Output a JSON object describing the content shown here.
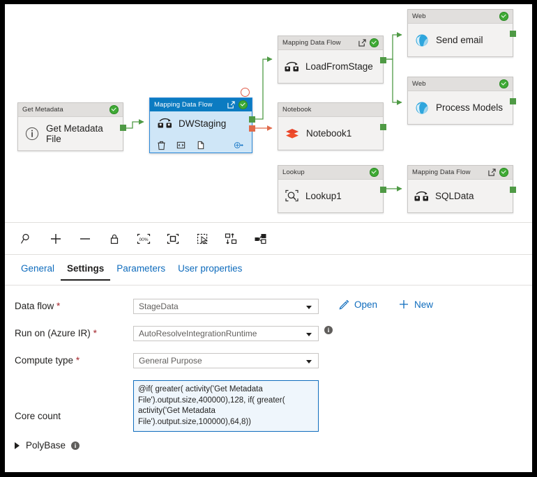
{
  "canvas": {
    "nodes": [
      {
        "id": "get-metadata",
        "type_label": "Get Metadata",
        "name": "Get Metadata\nFile",
        "icon": "info-circle-icon",
        "status": "valid",
        "selected": false
      },
      {
        "id": "dwstaging",
        "type_label": "Mapping Data Flow",
        "name": "DWStaging",
        "icon": "data-flow-icon",
        "status": "valid",
        "selected": true
      },
      {
        "id": "loadfromstage",
        "type_label": "Mapping Data Flow",
        "name": "LoadFromStage",
        "icon": "data-flow-icon",
        "status": "valid",
        "selected": false
      },
      {
        "id": "notebook1",
        "type_label": "Notebook",
        "name": "Notebook1",
        "icon": "databricks-notebook-icon",
        "status": "none",
        "selected": false
      },
      {
        "id": "lookup1",
        "type_label": "Lookup",
        "name": "Lookup1",
        "icon": "lookup-magnifier-icon",
        "status": "valid",
        "selected": false
      },
      {
        "id": "send-email",
        "type_label": "Web",
        "name": "Send email",
        "icon": "web-globe-icon",
        "status": "valid",
        "selected": false
      },
      {
        "id": "process-models",
        "type_label": "Web",
        "name": "Process Models",
        "icon": "web-globe-icon",
        "status": "valid",
        "selected": false
      },
      {
        "id": "sqldata",
        "type_label": "Mapping Data Flow",
        "name": "SQLData",
        "icon": "data-flow-icon",
        "status": "valid",
        "selected": false
      }
    ],
    "selected_node_actions": [
      "delete-icon",
      "code-icon",
      "clone-icon",
      "add-output-icon"
    ],
    "colors": {
      "success_green": "#3faa35",
      "connector_green": "#4f9a45",
      "connector_red": "#e06a4a",
      "selected_header": "#0b7bc1",
      "selected_body": "#cfe6f7"
    }
  },
  "toolbar": {
    "buttons": [
      {
        "name": "zoom-to-fit-icon",
        "title": "Zoom to fit"
      },
      {
        "name": "zoom-in-icon",
        "title": "Zoom in"
      },
      {
        "name": "zoom-out-icon",
        "title": "Zoom out"
      },
      {
        "name": "lock-icon",
        "title": "Lock"
      },
      {
        "name": "zoom-100-icon",
        "title": "100%"
      },
      {
        "name": "fit-to-screen-icon",
        "title": "Fit to screen"
      },
      {
        "name": "marquee-select-icon",
        "title": "Marquee select"
      },
      {
        "name": "auto-align-icon",
        "title": "Auto align"
      },
      {
        "name": "minimap-icon",
        "title": "Minimap"
      }
    ],
    "zoom_level_label": "00%"
  },
  "tabs": [
    {
      "label": "General",
      "active": false
    },
    {
      "label": "Settings",
      "active": true
    },
    {
      "label": "Parameters",
      "active": false
    },
    {
      "label": "User properties",
      "active": false
    }
  ],
  "settings": {
    "data_flow": {
      "label": "Data flow",
      "required": "*",
      "value": "StageData",
      "open_label": "Open",
      "new_label": "New"
    },
    "run_on": {
      "label": "Run on (Azure IR)",
      "required": "*",
      "value": "AutoResolveIntegrationRuntime",
      "info": "i"
    },
    "compute_type": {
      "label": "Compute type",
      "required": "*",
      "value": "General Purpose"
    },
    "core_count": {
      "label": "Core count",
      "value": "@if( greater( activity('Get Metadata File').output.size,400000),128, if( greater( activity('Get Metadata File').output.size,100000),64,8))"
    },
    "polybase": {
      "label": "PolyBase",
      "info": "i"
    }
  }
}
